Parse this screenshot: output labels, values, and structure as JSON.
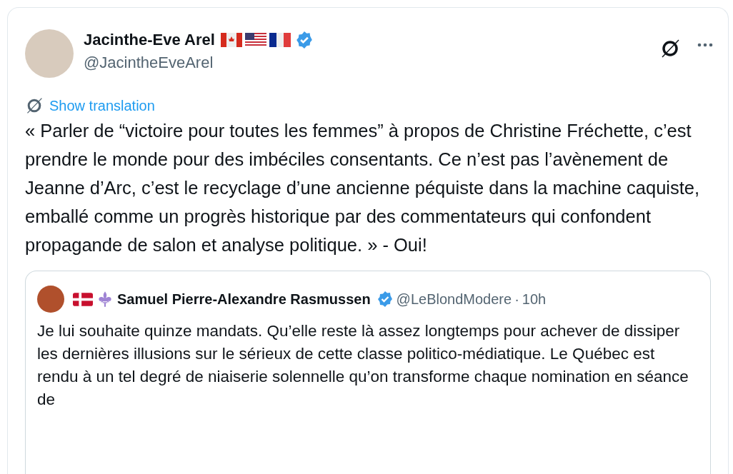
{
  "author": {
    "name": "Jacinthe-Eve Arel",
    "handle": "@JacintheEveArel",
    "verified": true
  },
  "translate": {
    "label": "Show translation"
  },
  "text": "« Parler de “victoire pour toutes les femmes” à propos de Christine Fréchette, c’est prendre le monde pour des imbéciles consentants. Ce n’est pas l’avènement de Jeanne d’Arc, c’est le recyclage d’une ancienne péquiste dans la machine caquiste, emballé comme un progrès historique par des commentateurs qui confondent propagande de salon et analyse politique. » - Oui!",
  "quote": {
    "name": "Samuel Pierre-Alexandre Rasmussen",
    "handle": "@LeBlondModere",
    "separator": "·",
    "time": "10h",
    "verified": true,
    "text": "Je lui souhaite quinze mandats. Qu’elle reste là assez longtemps pour achever de dissiper les dernières illusions sur le sérieux de cette classe politico-médiatique. Le Québec est rendu à un tel degré de niaiserie solennelle qu’on transforme chaque nomination en séance de"
  }
}
